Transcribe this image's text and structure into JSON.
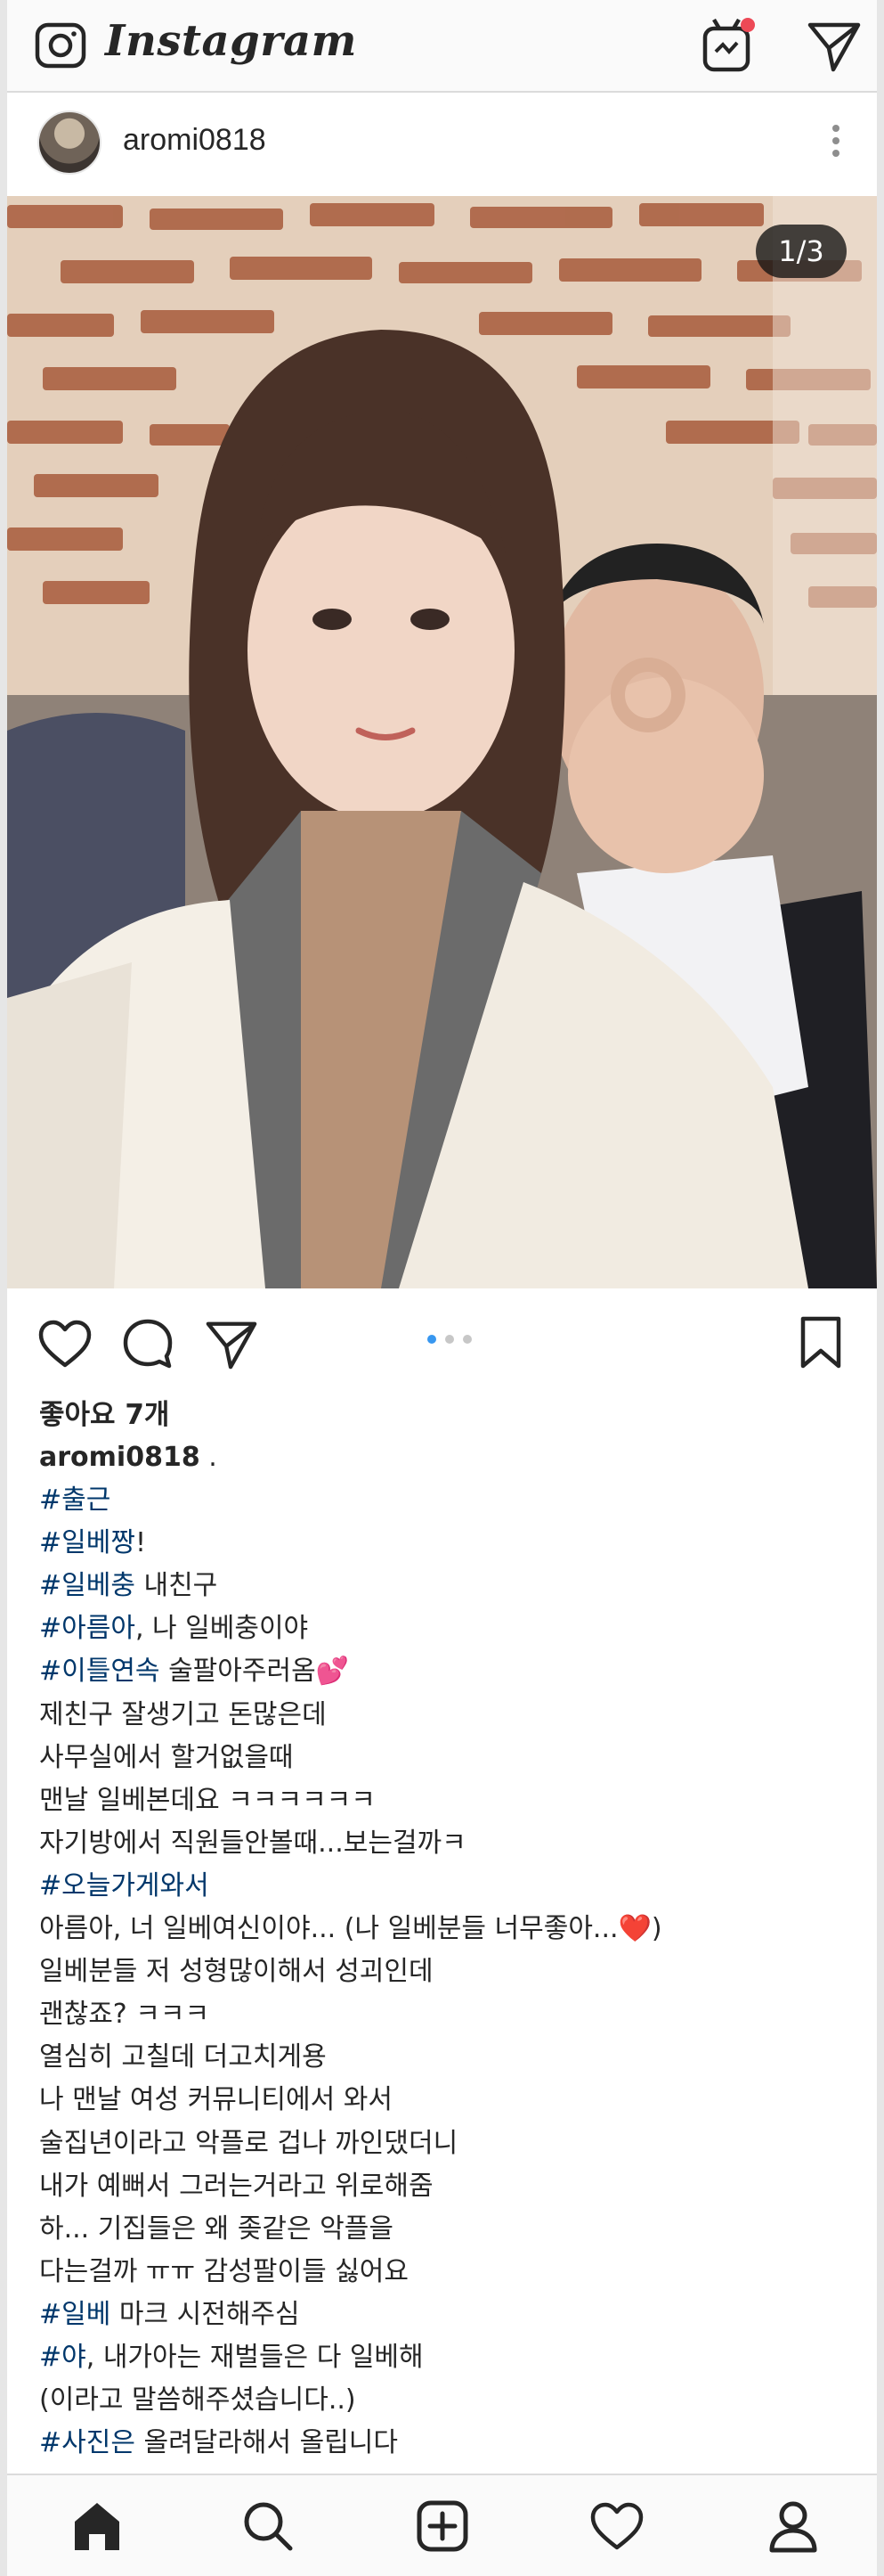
{
  "app": {
    "title": "Instagram",
    "unread_dot_color": "#ed4956"
  },
  "post": {
    "username": "aromi0818",
    "image_counter": "1/3",
    "likes": "좋아요 7개"
  },
  "caption": {
    "username": "aromi0818",
    "username_suffix": " .",
    "lines": [
      {
        "tag": "#출근",
        "text": ""
      },
      {
        "tag": "#일베짱",
        "text": "!"
      },
      {
        "tag": "#일베충",
        "text": " 내친구"
      },
      {
        "tag": "#아름아",
        "text": ", 나 일베충이야"
      },
      {
        "tag": "#이틀연속",
        "text": " 술팔아주러옴💕"
      },
      {
        "tag": "",
        "text": "제친구 잘생기고 돈많은데"
      },
      {
        "tag": "",
        "text": "사무실에서 할거없을때"
      },
      {
        "tag": "",
        "text": "맨날 일베본데요 ㅋㅋㅋㅋㅋㅋ"
      },
      {
        "tag": "",
        "text": "자기방에서 직원들안볼때...보는걸까ㅋ"
      },
      {
        "tag": "#오늘가게와서",
        "text": ""
      },
      {
        "tag": "",
        "text": "아름아, 너 일베여신이야... (나 일베분들 너무좋아...",
        "heart": "❤️",
        "after": ")"
      },
      {
        "tag": "",
        "text": "일베분들 저 성형많이해서 성괴인데"
      },
      {
        "tag": "",
        "text": "괜찮죠? ㅋㅋㅋ"
      },
      {
        "tag": "",
        "text": "열심히 고칠데 더고치게용"
      },
      {
        "tag": "",
        "text": "나 맨날 여성 커뮤니티에서 와서"
      },
      {
        "tag": "",
        "text": "술집년이라고 악플로 겁나 까인댔더니"
      },
      {
        "tag": "",
        "text": "내가 예뻐서 그러는거라고 위로해줌"
      },
      {
        "tag": "",
        "text": "하... 기집들은 왜 좆같은 악플을"
      },
      {
        "tag": "",
        "text": "다는걸까 ㅠㅠ 감성팔이들 싫어요"
      },
      {
        "tag": "#일베",
        "text": " 마크 시전해주심"
      },
      {
        "tag": "#야",
        "text": ", 내가아는 재벌들은 다 일베해"
      },
      {
        "tag": "",
        "text": "(이라고 말씀해주셨습니다..)"
      },
      {
        "tag": "#사진은",
        "text": " 올려달라해서 올립니다"
      }
    ]
  },
  "colors": {
    "hashtag": "#00376b",
    "active_dot": "#3897f0",
    "inactive_dot": "#c7c7c7"
  },
  "icons": {
    "camera": "camera-icon",
    "igtv": "igtv-icon",
    "direct": "direct-message-icon",
    "like": "heart-icon",
    "comment": "comment-icon",
    "share": "share-icon",
    "save": "bookmark-icon",
    "home": "home-icon",
    "search": "search-icon",
    "new_post": "new-post-icon",
    "activity": "activity-heart-icon",
    "profile": "profile-icon"
  }
}
